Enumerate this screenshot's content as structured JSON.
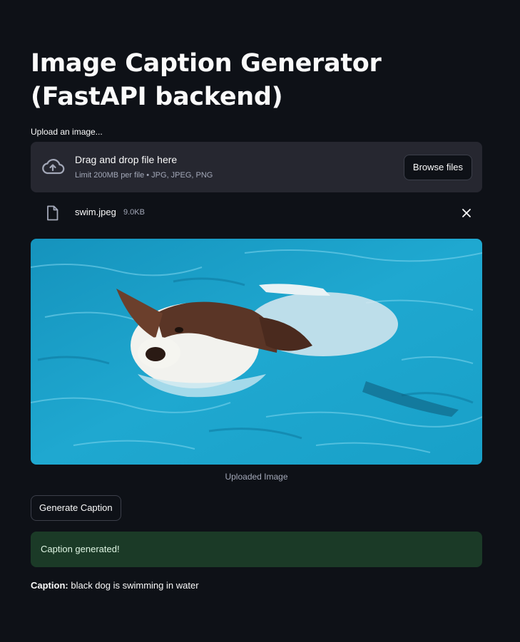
{
  "page": {
    "title": "Image Caption Generator (FastAPI backend)"
  },
  "uploader": {
    "label": "Upload an image...",
    "drop_title": "Drag and drop file here",
    "drop_subtitle": "Limit 200MB per file • JPG, JPEG, PNG",
    "browse_label": "Browse files",
    "icon": "cloud-upload-icon"
  },
  "file": {
    "name": "swim.jpeg",
    "size": "9.0KB",
    "icon": "file-icon",
    "remove_icon": "close-icon"
  },
  "image": {
    "caption": "Uploaded Image",
    "water_color": "#1fa3c9"
  },
  "actions": {
    "generate_label": "Generate Caption"
  },
  "status": {
    "message": "Caption generated!",
    "color": "#1b3a27"
  },
  "result": {
    "label": "Caption:",
    "text": "black dog is swimming in water"
  },
  "theme": {
    "background": "#0e1117",
    "panel": "#262730"
  }
}
